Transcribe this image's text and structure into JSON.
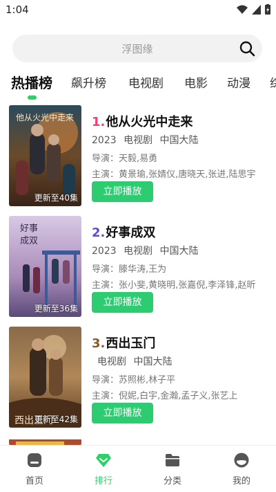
{
  "status_bar": {
    "time": "1:04"
  },
  "search": {
    "placeholder": "浮图缘"
  },
  "tabs": [
    {
      "label": "热播榜",
      "active": true
    },
    {
      "label": "飙升榜"
    },
    {
      "label": "电视剧"
    },
    {
      "label": "电影"
    },
    {
      "label": "动漫"
    },
    {
      "label": "综"
    }
  ],
  "items": [
    {
      "rank": "1.",
      "title": "他从火光中走来",
      "year": "2023",
      "category": "电视剧",
      "region": "中国大陆",
      "director": "导演：天毅,易勇",
      "cast": "主演：黄景瑜,张婧仪,唐晓天,张进,陆思宇",
      "badge": "更新至40集",
      "button": "立即播放",
      "rank_color": "#e8437a"
    },
    {
      "rank": "2.",
      "title": "好事成双",
      "year": "2023",
      "category": "电视剧",
      "region": "中国大陆",
      "director": "导演：滕华涛,王为",
      "cast": "主演：张小斐,黄晓明,张嘉倪,李泽锋,赵昕",
      "badge": "更新至36集",
      "button": "立即播放",
      "rank_color": "#5b4fd6"
    },
    {
      "rank": "3.",
      "title": "西出玉门",
      "year": "",
      "category": "电视剧",
      "region": "中国大陆",
      "director": "导演：苏照彬,林子平",
      "cast": "主演：倪妮,白宇,金瀚,孟子义,张艺上",
      "badge": "更新至42集",
      "button": "立即播放",
      "rank_color": "#8a5a2b"
    }
  ],
  "bottom_nav": [
    {
      "label": "首页",
      "icon": "home-icon"
    },
    {
      "label": "排行",
      "icon": "ranking-icon",
      "active": true
    },
    {
      "label": "分类",
      "icon": "category-folder-icon"
    },
    {
      "label": "我的",
      "icon": "profile-icon"
    }
  ],
  "colors": {
    "accent": "#2fcf6a",
    "button": "#2ecc71"
  }
}
